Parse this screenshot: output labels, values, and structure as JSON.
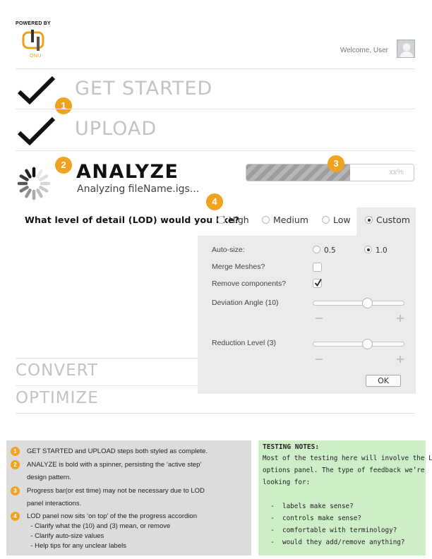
{
  "header": {
    "powered_by": "POWERED BY",
    "logo_name": "ONU",
    "welcome": "Welcome, User"
  },
  "steps": {
    "get_started": "GET STARTED",
    "upload": "UPLOAD",
    "analyze": "ANALYZE",
    "analyze_sub": "Analyzing fileName.igs...",
    "convert": "CONVERT",
    "optimize": "OPTIMIZE"
  },
  "progress": {
    "text": "xx%",
    "fraction": 0.62
  },
  "badges": [
    "1",
    "2",
    "3",
    "4"
  ],
  "lod": {
    "question": "What level of detail (LOD) would you like?",
    "options": [
      "High",
      "Medium",
      "Low",
      "Custom"
    ],
    "selected": "Custom"
  },
  "panel": {
    "autosize_label": "Auto-size:",
    "autosize_options": [
      "0.5",
      "1.0"
    ],
    "autosize_selected": "1.0",
    "merge_label": "Merge Meshes?",
    "merge_checked": false,
    "remove_label": "Remove components?",
    "remove_checked": true,
    "deviation_label": "Deviation Angle (10)",
    "deviation_value": 0.6,
    "reduction_label": "Reduction Level (3)",
    "reduction_value": 0.6,
    "ok_label": "OK"
  },
  "notes": {
    "items": [
      {
        "badge": "1",
        "lines": [
          "GET STARTED and UPLOAD steps both styled as complete."
        ]
      },
      {
        "badge": "2",
        "lines": [
          "ANALYZE is bold with a spinner, persisting the ‘active step’",
          "design pattern."
        ]
      },
      {
        "badge": "3",
        "lines": [
          "Progress bar(or est time) may not be necessary due to LOD",
          "panel interactions."
        ]
      },
      {
        "badge": "4",
        "lines": [
          "LOD panel now sits ‘on top’ of the the progress accordion",
          "  - Clarify what the (10) and (3) mean, or remove",
          "  - Clarify auto-size values",
          "  - Help tips for any unclear labels"
        ]
      }
    ],
    "testing_title": "TESTING NOTES:",
    "testing_lines": [
      "Most of the testing here will involve the LOD",
      "options panel. The type of feedback we’re",
      "looking for:",
      "",
      "  -  labels make sense?",
      "  -  controls make sense?",
      "  -  comfortable with terminology?",
      "  -  would they add/remove anything?"
    ]
  },
  "colors": {
    "accent": "#f0a321",
    "panel_bg": "#e9ebec",
    "notes_gray": "#dcdcdc",
    "notes_green": "#ceeec8",
    "inactive_step": "#c3c3c3"
  }
}
